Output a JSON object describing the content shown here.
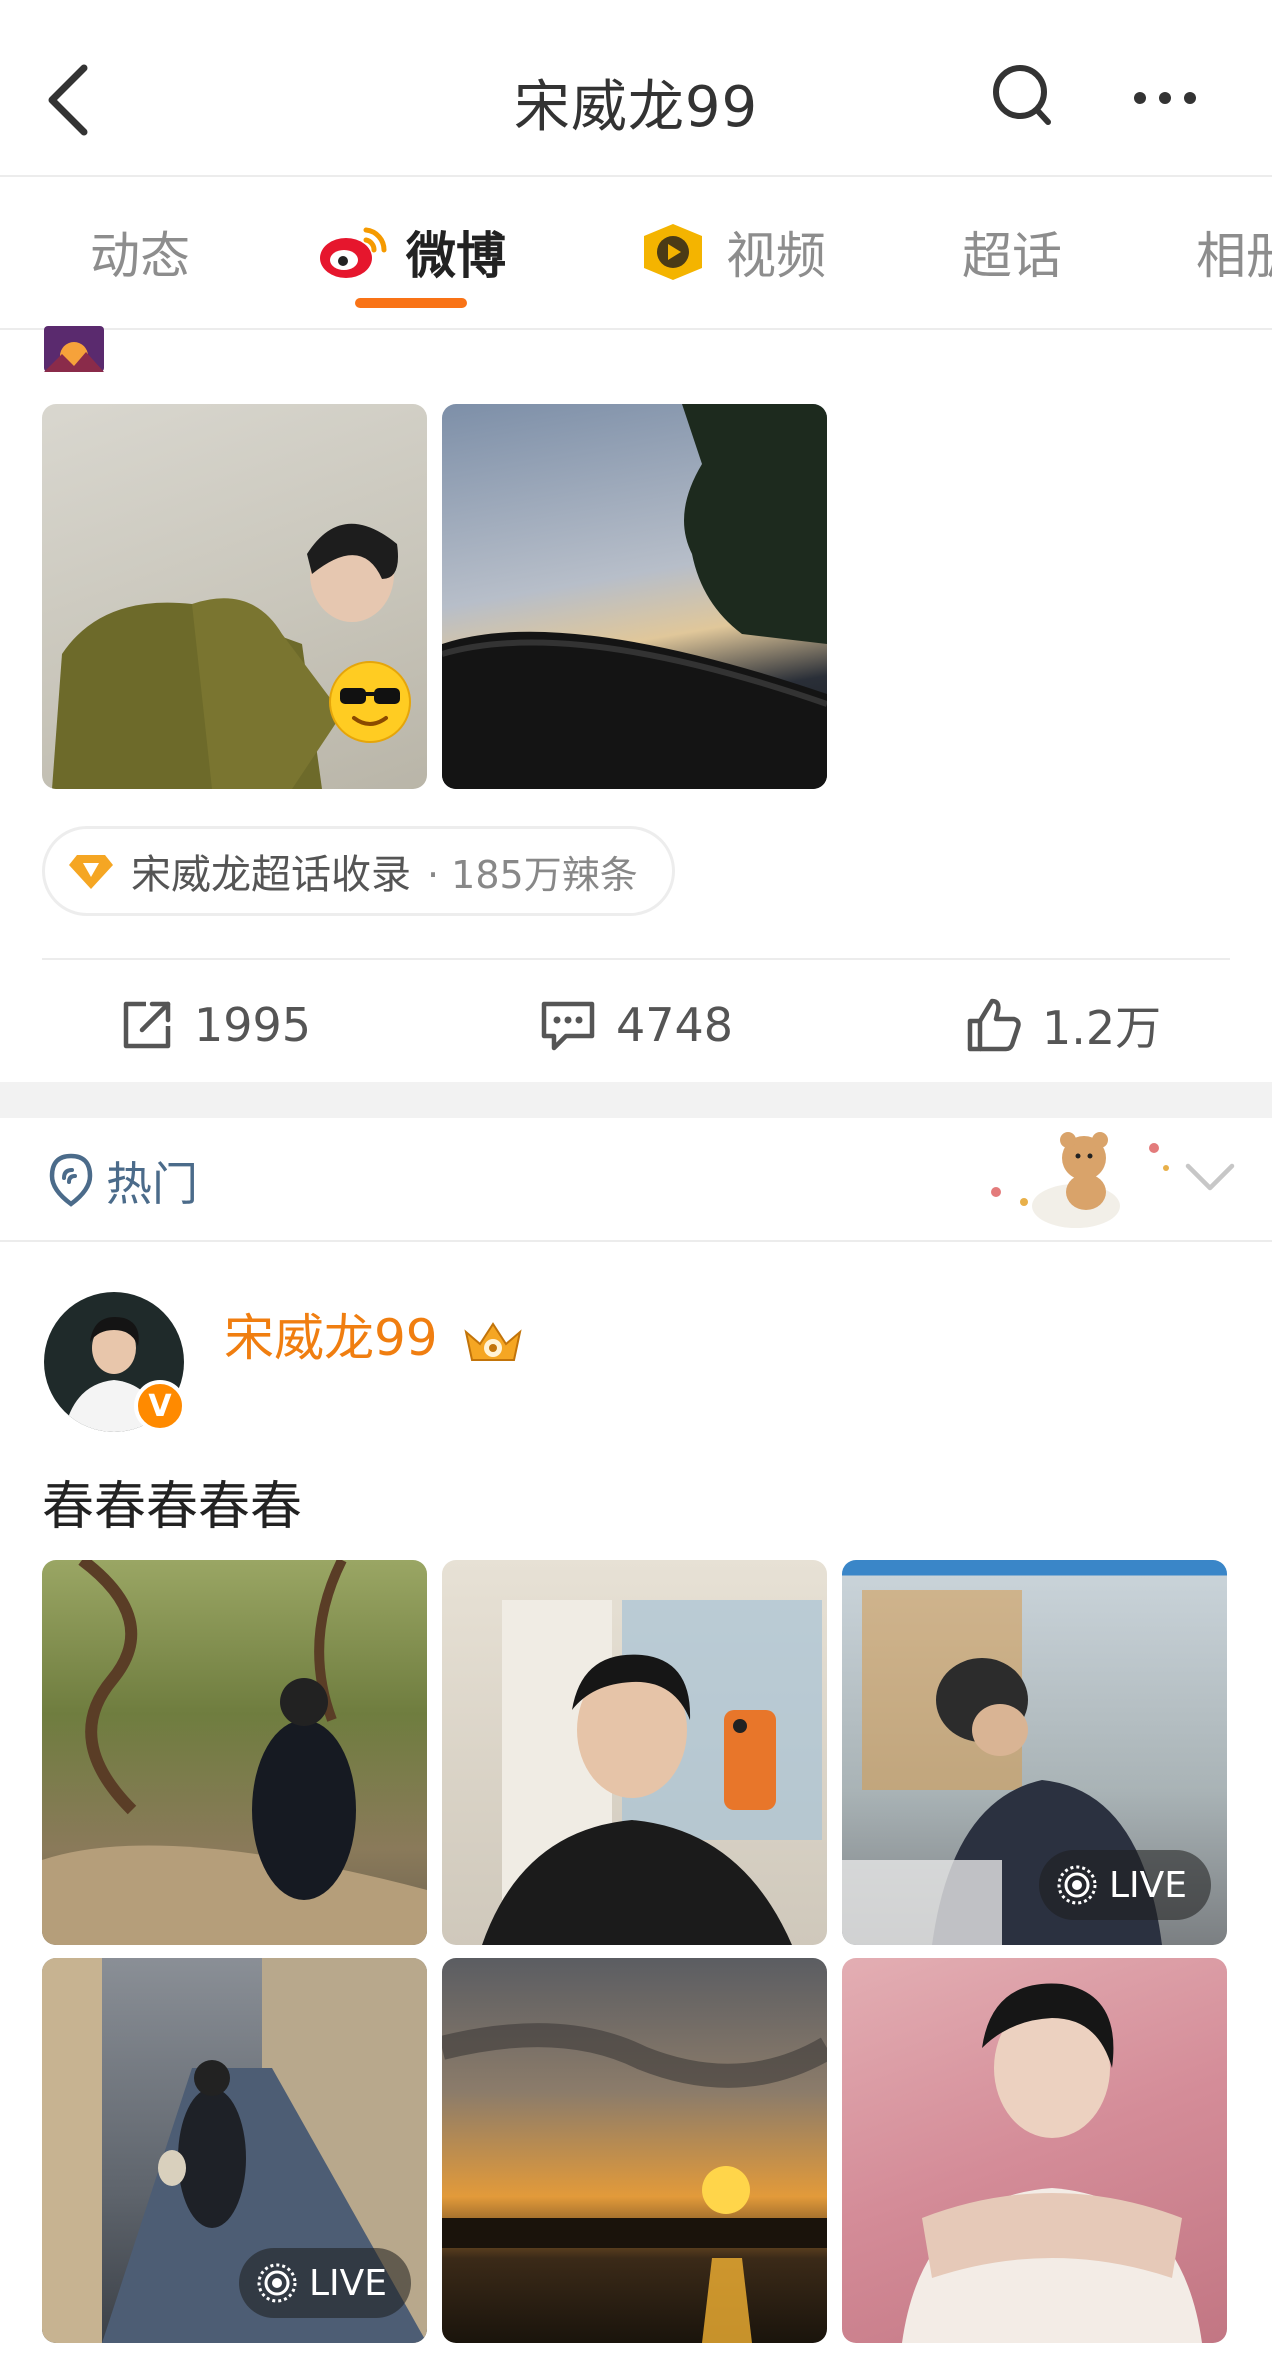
{
  "header": {
    "title": "宋威龙99"
  },
  "tabs": [
    {
      "label": "动态"
    },
    {
      "label": "微博"
    },
    {
      "label": "视频"
    },
    {
      "label": "超话"
    },
    {
      "label": "相册"
    }
  ],
  "post1": {
    "topic_chip": {
      "label": "宋威龙超话收录",
      "sub": "· 185万辣条"
    },
    "actions": {
      "repost": "1995",
      "comment": "4748",
      "like": "1.2万"
    }
  },
  "hot_bar": {
    "label": "热门"
  },
  "post2": {
    "username": "宋威龙99",
    "verified_badge": "V",
    "text": "春春春春春",
    "live_label": "LIVE"
  },
  "colors": {
    "accent_orange": "#f97316",
    "username_orange": "#f07e10",
    "hot_blue": "#4b6b8a",
    "chip_gold": "#f5a623"
  }
}
